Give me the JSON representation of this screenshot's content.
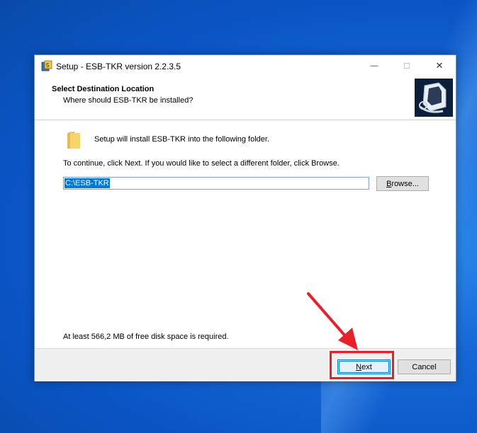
{
  "window": {
    "title": "Setup - ESB-TKR version 2.2.3.5",
    "minimize_glyph": "—",
    "maximize_glyph": "☐",
    "close_glyph": "✕"
  },
  "header": {
    "title": "Select Destination Location",
    "subtitle": "Where should ESB-TKR be installed?"
  },
  "body": {
    "install_text": "Setup will install ESB-TKR into the following folder.",
    "continue_text": "To continue, click Next. If you would like to select a different folder, click Browse.",
    "path_value": "C:\\ESB-TKR",
    "browse_label_prefix": "B",
    "browse_label_rest": "rowse...",
    "disk_space_text": "At least 566,2 MB of free disk space is required."
  },
  "footer": {
    "next_label_prefix": "N",
    "next_label_rest": "ext",
    "cancel_label": "Cancel"
  },
  "annotation": {
    "color": "#e8202a"
  },
  "icons": [
    "app-icon",
    "folder-icon",
    "setup-logo-icon",
    "arrow-annotation-icon"
  ]
}
